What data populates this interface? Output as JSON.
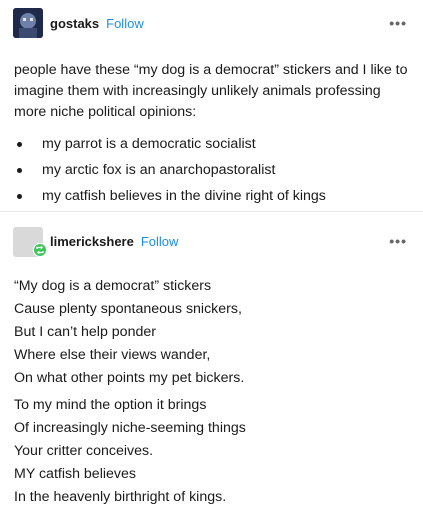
{
  "post1": {
    "username": "gostaks",
    "follow_label": "Follow",
    "more_icon": "more-horizontal-icon",
    "text": "people have these “my dog is a democrat” stickers and I like to imagine them with increasingly unlikely animals professing more niche political opinions:",
    "bullets": [
      "my parrot is a democratic socialist",
      "my arctic fox is an anarchopastoralist",
      "my catfish believes in the divine right of kings"
    ]
  },
  "post2": {
    "username": "limerickshere",
    "follow_label": "Follow",
    "badge_icon": "reblog-icon",
    "more_icon": "more-horizontal-icon",
    "stanza1": [
      "“My dog is a democrat” stickers",
      "Cause plenty spontaneous snickers,",
      "But I can’t help ponder",
      "Where else their views wander,",
      "On what other points my pet bickers."
    ],
    "stanza2": [
      "To my mind the option it brings",
      "Of increasingly niche-seeming things",
      "Your critter conceives.",
      "MY catfish believes",
      "In the heavenly birthright of kings."
    ]
  },
  "colors": {
    "follow": "#1b8fe0",
    "reblog_badge": "#3cc65c",
    "divider": "#e6e6e6"
  }
}
